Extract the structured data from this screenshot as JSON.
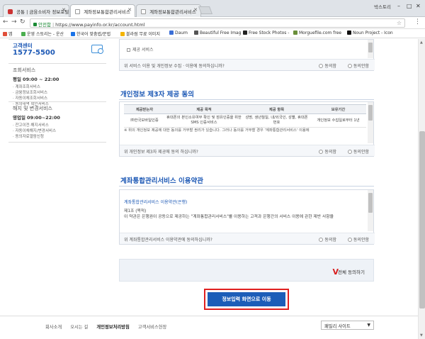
{
  "browser": {
    "tabs": [
      {
        "title": "공통 | 금융소비자 정보포털"
      },
      {
        "title": "계좌정보통합관리서비스"
      },
      {
        "title": "계좌정보통합관리서비스"
      }
    ],
    "user": "박스토리",
    "omnibox": {
      "secure_label": "안전함",
      "url": "https://www.payinfo.or.kr/account.html"
    },
    "bookmarks": [
      {
        "label": "앱",
        "color": "#e04e39"
      },
      {
        "label": "운영 스토리는 - 운산",
        "color": "#4caf50"
      },
      {
        "label": "한국어 맞춤법/문법",
        "color": "#1a73e8"
      },
      {
        "label": "블라썸 무료 이미지",
        "color": "#f4b400"
      },
      {
        "label": "Daum",
        "color": "#3b6fd6"
      },
      {
        "label": "Beautiful Free Imag",
        "color": "#555555"
      },
      {
        "label": "Free Stock Photos -",
        "color": "#222222"
      },
      {
        "label": "Morguefile.com free",
        "color": "#6a8f3a"
      },
      {
        "label": "Noun Project - Icon",
        "color": "#111111"
      }
    ]
  },
  "sidebar": {
    "cc_label": "고객센터",
    "cc_phone": "1577-5500",
    "svc1": {
      "title": "조회서비스",
      "hours_label": "평일",
      "hours": "09:00 ~ 22:00",
      "items": [
        "· 계좌조회서비스",
        "· 금융정보조회서비스",
        "· 자동이체조회서비스",
        "· 동의내역 확인서비스"
      ]
    },
    "svc2": {
      "title": "해지 및 변경서비스",
      "hours_label": "영업일",
      "hours": "09:00~22:00",
      "items": [
        "· 잔고이전·해지서비스",
        "· 자동이체해지/변경서비스",
        "· 동의자료열람신청"
      ]
    }
  },
  "section1": {
    "check_item": "제공 서비스",
    "agree_question": "위 서비스 이용 및 개인정보 수집 · 이용에 동의하십니까?",
    "agree": "동의함",
    "disagree": "동의안함"
  },
  "section2": {
    "title": "개인정보 제3자 제공 동의",
    "columns": [
      "제공받는자",
      "제공 목적",
      "제공 항목",
      "보유기간"
    ],
    "row": {
      "recipient": "㈜한국모바일인증",
      "purpose": "휴대폰의 본인소유여부 확인 및 점유인증을 위한 SMS 인증서비스",
      "items": "성명, 생년월일, 내/외국인, 성별, 휴대폰번호",
      "period": "개인정보 수집일로부터 1년"
    },
    "note": "※ 위의 개인정보 제공에 대한 동의를 거부할 권리가 있습니다. 그러나 동의를 거부할 경우 '계좌통합관리서비스' 이용에",
    "agree_question": "위 개인정보 제3자 제공에 동의 하십니까?",
    "agree": "동의함",
    "disagree": "동의안함"
  },
  "section3": {
    "title": "계좌통합관리서비스 이용약관",
    "terms_heading": "계좌통합관리서비스 이용약관(은행)",
    "article": "제1조 (목적)",
    "article_text": "이 약관은 은행권이 공동으로 제공하는 \"계좌통합관리서비스\"를 이용하는 고객과 은행간의 서비스 이용에 관한 제반 사항을",
    "agree_question": "위 계좌통합관리서비스 이용약관에 동의하십니까?",
    "agree": "동의함",
    "disagree": "동의안함"
  },
  "all_agree": {
    "label": "전체 동의하기"
  },
  "submit": {
    "label": "정보입력 화면으로 이동"
  },
  "footer": {
    "links": [
      "회사소개",
      "오시는 길",
      "개인정보처리방침",
      "고객서비스헌장"
    ],
    "family_site": "패밀리 사이트"
  }
}
